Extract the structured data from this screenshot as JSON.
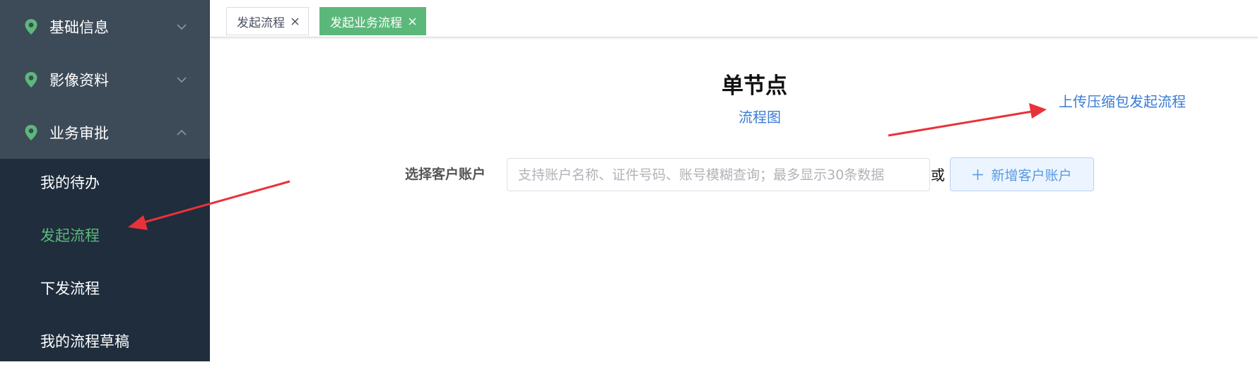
{
  "sidebar": {
    "groups": [
      {
        "label": "基础信息",
        "icon": "location-pin-icon",
        "expanded": false
      },
      {
        "label": "影像资料",
        "icon": "location-pin-icon",
        "expanded": false
      },
      {
        "label": "业务审批",
        "icon": "location-pin-icon",
        "expanded": true
      }
    ],
    "items": [
      {
        "label": "我的待办",
        "active": false
      },
      {
        "label": "发起流程",
        "active": true
      },
      {
        "label": "下发流程",
        "active": false
      },
      {
        "label": "我的流程草稿",
        "active": false
      }
    ]
  },
  "tabs": [
    {
      "label": "发起流程",
      "active": false
    },
    {
      "label": "发起业务流程",
      "active": true
    }
  ],
  "main": {
    "title": "单节点",
    "flow_link": "流程图",
    "upload_link": "上传压缩包发起流程",
    "form": {
      "label": "选择客户账户",
      "input_value": "",
      "input_placeholder": "支持账户名称、证件号码、账号模糊查询；最多显示30条数据",
      "or_text": "或",
      "add_button_label": "新增客户账户"
    }
  },
  "colors": {
    "sidebar_bg": "#1f2d3d",
    "group_bg": "#3d4a58",
    "accent_green": "#5cb87a",
    "link_blue": "#3a7bd5",
    "annotation_red": "#e8323a"
  }
}
